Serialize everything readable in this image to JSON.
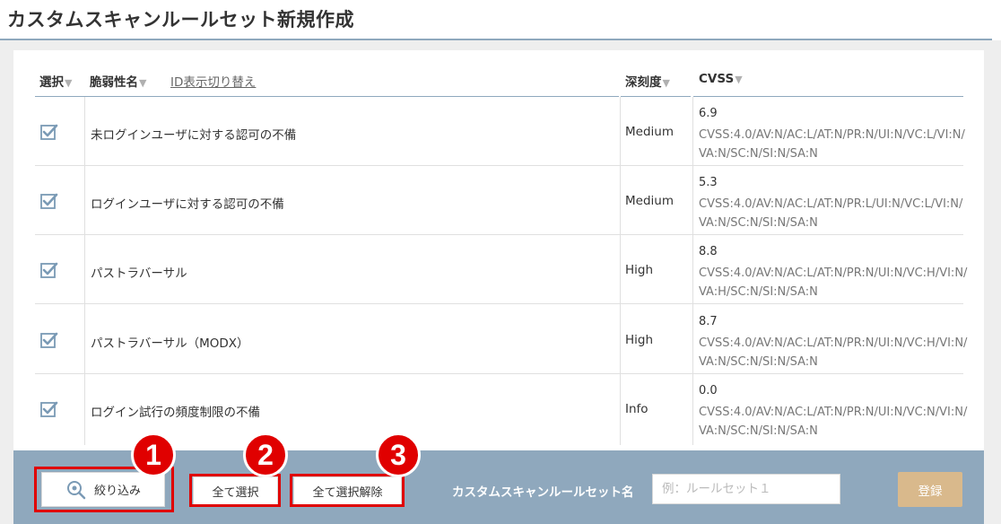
{
  "page": {
    "title": "カスタムスキャンルールセット新規作成"
  },
  "table": {
    "headers": {
      "select": "選択",
      "vuln_name": "脆弱性名",
      "id_toggle": "ID表示切り替え",
      "severity": "深刻度",
      "cvss": "CVSS"
    },
    "sort_glyph": "▼",
    "rows": [
      {
        "name": "未ログインユーザに対する認可の不備",
        "severity": "Medium",
        "score": "6.9",
        "vector": "CVSS:4.0/AV:N/AC:L/AT:N/PR:N/UI:N/VC:L/VI:N/VA:N/SC:N/SI:N/SA:N",
        "checked": true
      },
      {
        "name": "ログインユーザに対する認可の不備",
        "severity": "Medium",
        "score": "5.3",
        "vector": "CVSS:4.0/AV:N/AC:L/AT:N/PR:L/UI:N/VC:L/VI:N/VA:N/SC:N/SI:N/SA:N",
        "checked": true
      },
      {
        "name": "パストラバーサル",
        "severity": "High",
        "score": "8.8",
        "vector": "CVSS:4.0/AV:N/AC:L/AT:N/PR:N/UI:N/VC:H/VI:N/VA:H/SC:N/SI:N/SA:N",
        "checked": true
      },
      {
        "name": "パストラバーサル（MODX）",
        "severity": "High",
        "score": "8.7",
        "vector": "CVSS:4.0/AV:N/AC:L/AT:N/PR:N/UI:N/VC:H/VI:N/VA:N/SC:N/SI:N/SA:N",
        "checked": true
      },
      {
        "name": "ログイン試行の頻度制限の不備",
        "severity": "Info",
        "score": "0.0",
        "vector": "CVSS:4.0/AV:N/AC:L/AT:N/PR:N/UI:N/VC:N/VI:N/VA:N/SC:N/SI:N/SA:N",
        "checked": true
      }
    ]
  },
  "toolbar": {
    "filter_label": "絞り込み",
    "select_all_label": "全て選択",
    "deselect_all_label": "全て選択解除",
    "ruleset_name_label": "カスタムスキャンルールセット名",
    "ruleset_name_placeholder": "例：ルールセット１",
    "register_label": "登録"
  },
  "annotations": {
    "badge_1": "1",
    "badge_2": "2",
    "badge_3": "3"
  },
  "colors": {
    "accent_steel": "#8fa8bd",
    "callout_red": "#e00000",
    "register_tan": "#d9b98c",
    "checkbox_blue": "#7a9ab5"
  },
  "icons": {
    "checkbox": "checkbox-checked-icon",
    "filter": "filter-search-icon"
  }
}
